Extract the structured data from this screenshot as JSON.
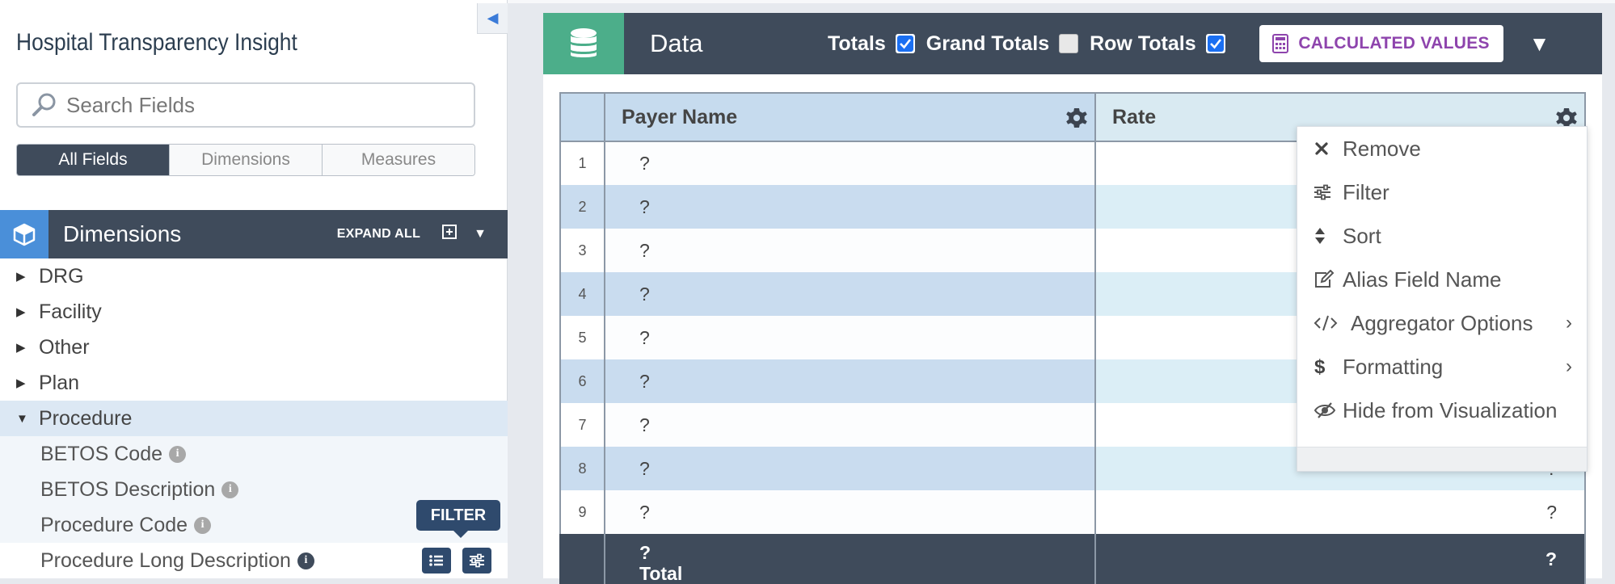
{
  "app": {
    "title": "Hospital Transparency Insight"
  },
  "search": {
    "placeholder": "Search Fields"
  },
  "field_tabs": [
    {
      "label": "All Fields",
      "active": true
    },
    {
      "label": "Dimensions",
      "active": false
    },
    {
      "label": "Measures",
      "active": false
    }
  ],
  "dimensions": {
    "title": "Dimensions",
    "expand_all": "EXPAND ALL",
    "folders": [
      "DRG",
      "Facility",
      "Other",
      "Plan",
      "Procedure"
    ],
    "procedure_fields": [
      "BETOS Code",
      "BETOS Description",
      "Procedure Code",
      "Procedure Long Description"
    ],
    "tooltip": "FILTER"
  },
  "data_panel": {
    "title": "Data",
    "totals_label": "Totals",
    "totals_checked": true,
    "grand_totals_label": "Grand Totals",
    "grand_totals_checked": false,
    "row_totals_label": "Row Totals",
    "row_totals_checked": true,
    "calc_button": "CALCULATED VALUES",
    "accent_color": "#4cae8a",
    "calc_color": "#8e44ad"
  },
  "table": {
    "columns": [
      "Payer Name",
      "Rate"
    ],
    "rows": [
      {
        "idx": "1",
        "payer": "?",
        "rate": ""
      },
      {
        "idx": "2",
        "payer": "?",
        "rate": ""
      },
      {
        "idx": "3",
        "payer": "?",
        "rate": ""
      },
      {
        "idx": "4",
        "payer": "?",
        "rate": ""
      },
      {
        "idx": "5",
        "payer": "?",
        "rate": ""
      },
      {
        "idx": "6",
        "payer": "?",
        "rate": ""
      },
      {
        "idx": "7",
        "payer": "?",
        "rate": ""
      },
      {
        "idx": "8",
        "payer": "?",
        "rate": "?"
      },
      {
        "idx": "9",
        "payer": "?",
        "rate": "?"
      }
    ],
    "total_row": {
      "payer_line1": "?",
      "payer_line2": "Total",
      "rate": "?"
    }
  },
  "context_menu": {
    "items": [
      {
        "label": "Remove",
        "icon": "times-icon",
        "submenu": false
      },
      {
        "label": "Filter",
        "icon": "sliders-icon",
        "submenu": false
      },
      {
        "label": "Sort",
        "icon": "sort-icon",
        "submenu": false
      },
      {
        "label": "Alias Field Name",
        "icon": "edit-icon",
        "submenu": false
      },
      {
        "label": "Aggregator Options",
        "icon": "code-icon",
        "submenu": true
      },
      {
        "label": "Formatting",
        "icon": "dollar-icon",
        "submenu": true
      },
      {
        "label": "Hide from Visualization",
        "icon": "eye-slash-icon",
        "submenu": false
      }
    ]
  }
}
